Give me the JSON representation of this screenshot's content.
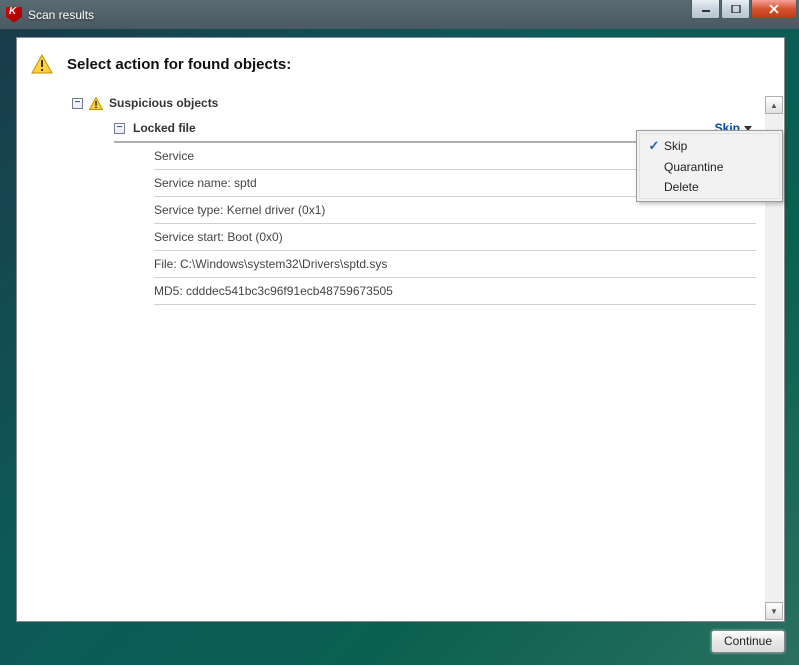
{
  "window": {
    "title": "Scan results"
  },
  "heading": "Select action for found objects:",
  "tree": {
    "group_label": "Suspicious objects",
    "item_label": "Locked file",
    "action_link": "Skip"
  },
  "details": [
    "Service",
    "Service name: sptd",
    "Service type: Kernel driver (0x1)",
    "Service start: Boot (0x0)",
    "File: C:\\Windows\\system32\\Drivers\\sptd.sys",
    "MD5: cdddec541bc3c96f91ecb48759673505"
  ],
  "menu": {
    "items": [
      {
        "label": "Skip",
        "checked": true
      },
      {
        "label": "Quarantine",
        "checked": false
      },
      {
        "label": "Delete",
        "checked": false
      }
    ]
  },
  "footer": {
    "continue": "Continue"
  }
}
